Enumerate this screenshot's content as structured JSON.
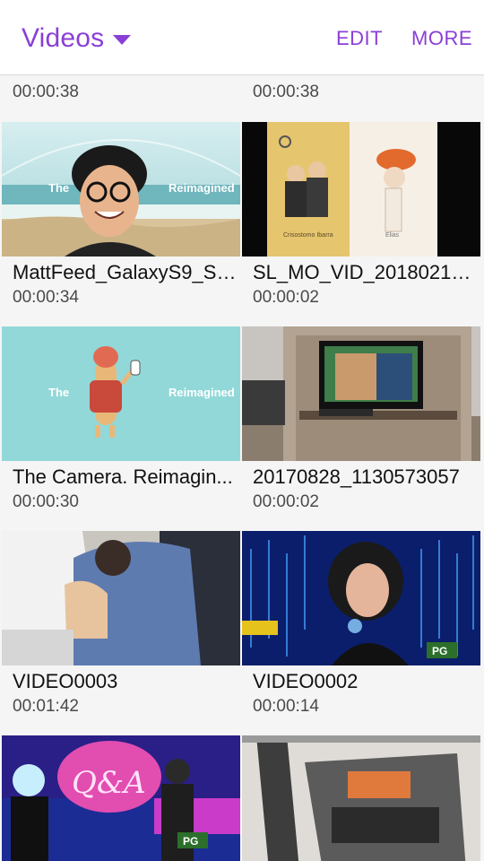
{
  "app": {
    "title": "Videos",
    "actions": {
      "edit": "EDIT",
      "more": "MORE"
    },
    "accent_color": "#8a3fd6"
  },
  "grid": {
    "partial_top": [
      {
        "duration": "00:00:38"
      },
      {
        "duration": "00:00:38"
      }
    ],
    "items": [
      {
        "name": "MattFeed_GalaxyS9_SA...",
        "duration": "00:00:34",
        "thumb_text_left": "The",
        "thumb_text_right": "Reimagined"
      },
      {
        "name": "SL_MO_VID_20180213...",
        "duration": "00:00:02",
        "thumb_caption_left": "Crisostomo Ibarra",
        "thumb_caption_right": "Elias"
      },
      {
        "name": "The Camera. Reimagin...",
        "duration": "00:00:30",
        "thumb_text_left": "The",
        "thumb_text_right": "Reimagined"
      },
      {
        "name": "20170828_1130573057",
        "duration": "00:00:02"
      },
      {
        "name": "VIDEO0003",
        "duration": "00:01:42"
      },
      {
        "name": "VIDEO0002",
        "duration": "00:00:14",
        "thumb_badge": "PG"
      },
      {
        "name": "",
        "duration": "",
        "thumb_badge": "PG"
      },
      {
        "name": "",
        "duration": ""
      }
    ]
  }
}
